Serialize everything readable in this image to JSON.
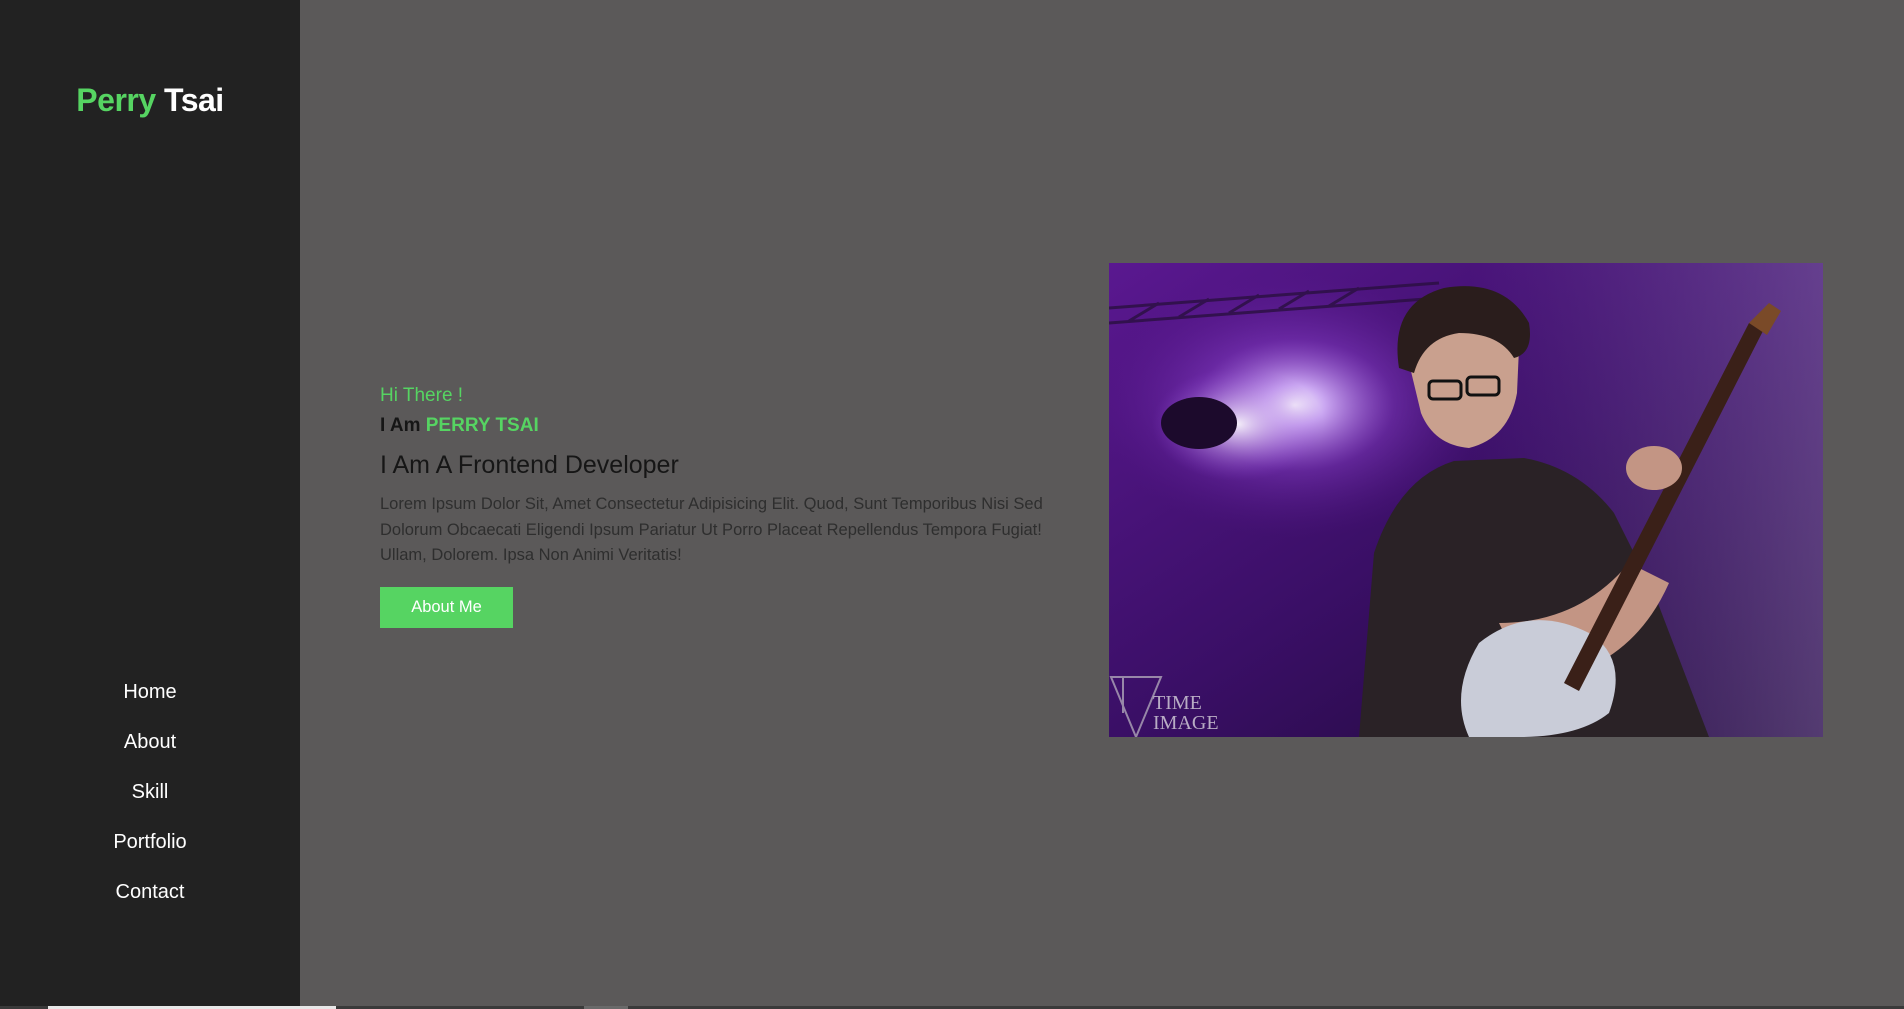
{
  "sidebar": {
    "logo_first": "Perry",
    "logo_last": "Tsai",
    "nav": [
      {
        "label": "Home"
      },
      {
        "label": "About"
      },
      {
        "label": "Skill"
      },
      {
        "label": "Portfolio"
      },
      {
        "label": "Contact"
      }
    ]
  },
  "hero": {
    "greeting": "Hi There !",
    "iam_prefix": "I Am",
    "name": "PERRY TSAI",
    "role": "I Am A Frontend Developer",
    "description": "Lorem Ipsum Dolor Sit, Amet Consectetur Adipisicing Elit. Quod, Sunt Temporibus Nisi Sed Dolorum Obcaecati Eligendi Ipsum Pariatur Ut Porro Placeat Repellendus Tempora Fugiat! Ullam, Dolorem. Ipsa Non Animi Veritatis!",
    "button_label": "About Me",
    "photo_watermark_line1": "TIME",
    "photo_watermark_line2": "IMAGE"
  },
  "colors": {
    "accent": "#56d462",
    "sidebar_bg": "#222222",
    "main_bg": "#5b5959"
  }
}
